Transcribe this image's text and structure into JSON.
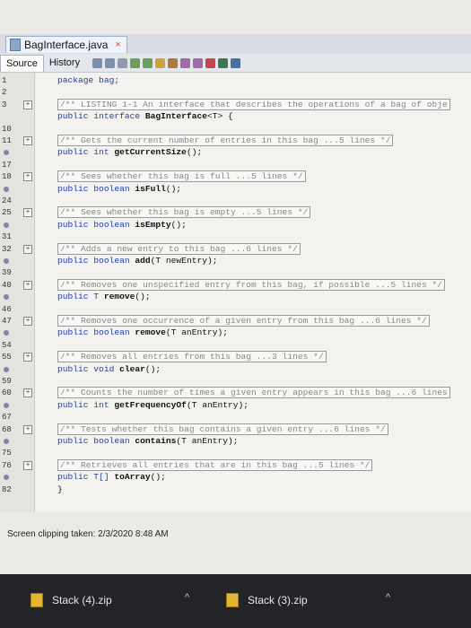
{
  "editor": {
    "tab_title": "BagInterface.java",
    "close_glyph": "×",
    "source_tab": "Source",
    "history_tab": "History"
  },
  "lines": [
    {
      "n": "1",
      "code": [
        {
          "t": "package bag;",
          "c": "kw"
        }
      ]
    },
    {
      "n": "2",
      "code": []
    },
    {
      "n": "3",
      "fold": "+",
      "code": [
        {
          "t": "/** LISTING 1-1 An interface that describes the operations of a bag of obje",
          "c": "cmt box"
        }
      ]
    },
    {
      "n": "",
      "code": [
        {
          "t": "public interface ",
          "c": "kw"
        },
        {
          "t": "BagInterface",
          "c": "nm"
        },
        {
          "t": "<T> {",
          "c": ""
        }
      ]
    },
    {
      "n": "10",
      "code": []
    },
    {
      "n": "11",
      "fold": "+",
      "code": [
        {
          "t": "/** Gets the current number of entries in this bag ...5 lines */",
          "c": "cmt box"
        }
      ]
    },
    {
      "n": "",
      "dot": true,
      "code": [
        {
          "t": "public int ",
          "c": "kw"
        },
        {
          "t": "getCurrentSize",
          "c": "nm"
        },
        {
          "t": "();",
          "c": ""
        }
      ]
    },
    {
      "n": "17",
      "code": []
    },
    {
      "n": "18",
      "fold": "+",
      "code": [
        {
          "t": "/** Sees whether this bag is full ...5 lines */",
          "c": "cmt box"
        }
      ]
    },
    {
      "n": "",
      "dot": true,
      "code": [
        {
          "t": "public boolean ",
          "c": "kw"
        },
        {
          "t": "isFull",
          "c": "nm"
        },
        {
          "t": "();",
          "c": ""
        }
      ]
    },
    {
      "n": "24",
      "code": []
    },
    {
      "n": "25",
      "fold": "+",
      "code": [
        {
          "t": "/** Sees whether this bag is empty ...5 lines */",
          "c": "cmt box"
        }
      ]
    },
    {
      "n": "",
      "dot": true,
      "code": [
        {
          "t": "public boolean ",
          "c": "kw"
        },
        {
          "t": "isEmpty",
          "c": "nm"
        },
        {
          "t": "();",
          "c": ""
        }
      ]
    },
    {
      "n": "31",
      "code": []
    },
    {
      "n": "32",
      "fold": "+",
      "code": [
        {
          "t": "/** Adds a new entry to this bag ...6 lines */",
          "c": "cmt box"
        }
      ]
    },
    {
      "n": "",
      "dot": true,
      "code": [
        {
          "t": "public boolean ",
          "c": "kw"
        },
        {
          "t": "add",
          "c": "nm"
        },
        {
          "t": "(T newEntry);",
          "c": ""
        }
      ]
    },
    {
      "n": "39",
      "code": []
    },
    {
      "n": "40",
      "fold": "+",
      "code": [
        {
          "t": "/** Removes one unspecified entry from this bag, if possible ...5 lines */",
          "c": "cmt box"
        }
      ]
    },
    {
      "n": "",
      "dot": true,
      "code": [
        {
          "t": "public T ",
          "c": "kw"
        },
        {
          "t": "remove",
          "c": "nm"
        },
        {
          "t": "();",
          "c": ""
        }
      ]
    },
    {
      "n": "46",
      "code": []
    },
    {
      "n": "47",
      "fold": "+",
      "code": [
        {
          "t": "/** Removes one occurrence of a given entry from this bag ...6 lines */",
          "c": "cmt box"
        }
      ]
    },
    {
      "n": "",
      "dot": true,
      "code": [
        {
          "t": "public boolean ",
          "c": "kw"
        },
        {
          "t": "remove",
          "c": "nm"
        },
        {
          "t": "(T anEntry);",
          "c": ""
        }
      ]
    },
    {
      "n": "54",
      "code": []
    },
    {
      "n": "55",
      "fold": "+",
      "code": [
        {
          "t": "/** Removes all entries from this bag ...3 lines */",
          "c": "cmt box"
        }
      ]
    },
    {
      "n": "",
      "dot": true,
      "code": [
        {
          "t": "public void ",
          "c": "kw"
        },
        {
          "t": "clear",
          "c": "nm"
        },
        {
          "t": "();",
          "c": ""
        }
      ]
    },
    {
      "n": "59",
      "code": []
    },
    {
      "n": "60",
      "fold": "+",
      "code": [
        {
          "t": "/** Counts the number of times a given entry appears in this bag ...6 lines",
          "c": "cmt box"
        }
      ]
    },
    {
      "n": "",
      "dot": true,
      "code": [
        {
          "t": "public int ",
          "c": "kw"
        },
        {
          "t": "getFrequencyOf",
          "c": "nm"
        },
        {
          "t": "(T anEntry);",
          "c": ""
        }
      ]
    },
    {
      "n": "67",
      "code": []
    },
    {
      "n": "68",
      "fold": "+",
      "code": [
        {
          "t": "/** Tests whether this bag contains a given entry ...6 lines */",
          "c": "cmt box"
        }
      ]
    },
    {
      "n": "",
      "dot": true,
      "code": [
        {
          "t": "public boolean ",
          "c": "kw"
        },
        {
          "t": "contains",
          "c": "nm"
        },
        {
          "t": "(T anEntry);",
          "c": ""
        }
      ]
    },
    {
      "n": "75",
      "code": []
    },
    {
      "n": "76",
      "fold": "+",
      "code": [
        {
          "t": "/** Retrieves all entries that are in this bag ...5 lines */",
          "c": "cmt box"
        }
      ]
    },
    {
      "n": "",
      "dot": true,
      "code": [
        {
          "t": "public T[] ",
          "c": "kw"
        },
        {
          "t": "toArray",
          "c": "nm"
        },
        {
          "t": "();",
          "c": ""
        }
      ]
    },
    {
      "n": "82",
      "code": [
        {
          "t": "}",
          "c": ""
        }
      ]
    }
  ],
  "caption": "Screen clipping taken: 2/3/2020 8:48 AM",
  "taskbar": {
    "item1": "Stack (4).zip",
    "item2": "Stack (3).zip",
    "caret_glyph": "^"
  }
}
